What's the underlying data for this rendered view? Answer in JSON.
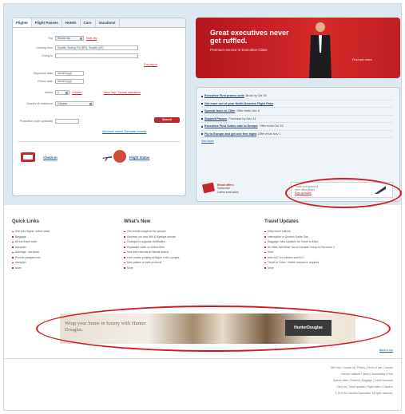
{
  "search_panel": {
    "tabs": [
      "Flights",
      "Flight Passes",
      "Hotels",
      "Cars",
      "Vacations"
    ],
    "trip_label": "Trip",
    "trip_value": "Round trip",
    "trip_link": "Multi city",
    "leaving_from_label": "Leaving from",
    "leaving_from_value": "Seattle, Boeing Fld (BFI), Seattle (US)",
    "going_to_label": "Going to",
    "going_to_value": "",
    "find_airport_link": "Find airport",
    "departure_label": "Departure date",
    "departure_value": "dd/mm/yyyy",
    "return_label": "Return date",
    "return_value": "dd/mm/yyyy",
    "adults_label": "Adults",
    "adults_value": "1",
    "children_link": "Children",
    "special_assistance_link": "Need help? Special assistance",
    "country_label": "Country of residence",
    "country_value": "Canada",
    "promotion_label": "Promotion code (optional)",
    "search_button": "Search",
    "advanced_links": "Advanced search | Aeroplan rewards",
    "check_in_label": "Check-in",
    "flight_status_label": "Flight Status"
  },
  "banner": {
    "headline": "Great executives never get ruffled.",
    "subtext": "Premium service in Executive Class",
    "cta": "Find out more"
  },
  "promos": {
    "items": [
      {
        "title": "Executive First promo code",
        "text": " Book by Oct 30"
      },
      {
        "title": "Get more out of your North America Flight Pass",
        "text": ""
      },
      {
        "title": "Special fares to Chile",
        "text": " Offer ends Nov 8"
      },
      {
        "title": "Student Passes",
        "text": " Purchase by Dec 31"
      },
      {
        "title": "Executive First Suites sale to Europe",
        "text": " Offer ends Oct 15"
      },
      {
        "title": "Fly to Europe and get one free night",
        "text": " Offer ends Nov 1"
      }
    ],
    "more_link": "See more",
    "email_title": "Email offers",
    "email_sub": "Subscribe",
    "email_sub2": "Latest seat sales",
    "visa_line1": "Track your spend &",
    "visa_line2": "earn miles faster",
    "visa_link": "Sign up today"
  },
  "columns": {
    "quick_links": {
      "title": "Quick Links",
      "items": [
        "See your flights, select seats",
        "Baggage",
        "All our travel tools",
        "Aeroplan",
        "Airbridge - Aeroplan",
        "Provide passport info",
        "Aeroplan",
        "More"
      ]
    },
    "whats_new": {
      "title": "What's New",
      "items": [
        "Get mobile usage on the ground",
        "Discover our new Wifi & Mystays service",
        "Changes to upgrade certificates",
        "Expanded cabin on Airbus fleet",
        "Now free haircuts at Hawaii airport",
        "Free mobile printing at Maple Leaf Lounges",
        "New pattern of seat products",
        "More"
      ]
    },
    "travel_updates": {
      "title": "Travel Updates",
      "items": [
        "Daily travel outlook",
        "Interruption in Quebec Radar Ops",
        "Baggage: New Updates for Travel to India",
        "Air Miles Will Allow You to Canada Group to Ferromex 2",
        "Sold",
        "New AST for children and ELC",
        "Travel to Cuba - Health Insurance required",
        "More"
      ]
    }
  },
  "ad": {
    "copy": "Wrap your home in luxury with Hunter Douglas.",
    "logo": "HunterDouglas"
  },
  "footer": {
    "top_link": "Back to top",
    "lines": [
      "Site map | Contact us | Privacy | Terms of use | Careers",
      "Investor relations | Media | Accessibility | Fees",
      "Special offers | Partners | Baggage | Travel insurance",
      "Carry-on | Travel updates | Flight status | Check-in",
      "© 2010 Air Canada Corporation. All rights reserved."
    ]
  },
  "colors": {
    "brand_red": "#c4262e",
    "link_blue": "#1b5a9a",
    "annotation_oval": "#d21a24"
  }
}
